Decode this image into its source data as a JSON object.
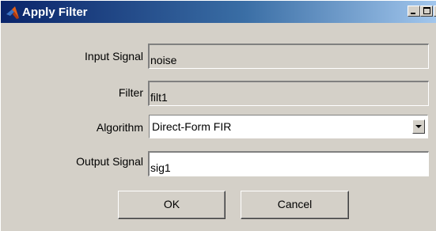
{
  "window": {
    "title": "Apply Filter",
    "controls": [
      "minimize",
      "maximize",
      "close"
    ]
  },
  "form": {
    "input_signal": {
      "label": "Input Signal",
      "value": "noise"
    },
    "filter": {
      "label": "Filter",
      "value": "filt1"
    },
    "algorithm": {
      "label": "Algorithm",
      "selected": "Direct-Form FIR"
    },
    "output_signal": {
      "label": "Output Signal",
      "value": "sig1"
    }
  },
  "buttons": {
    "ok": "OK",
    "cancel": "Cancel"
  },
  "icons": {
    "app": "matlab-icon",
    "minimize": "minimize-icon",
    "maximize": "maximize-icon",
    "close": "close-icon",
    "dropdown": "chevron-down-icon"
  },
  "colors": {
    "titlebar_start": "#0a246a",
    "titlebar_end": "#a6caf0",
    "face": "#d4d0c8"
  }
}
